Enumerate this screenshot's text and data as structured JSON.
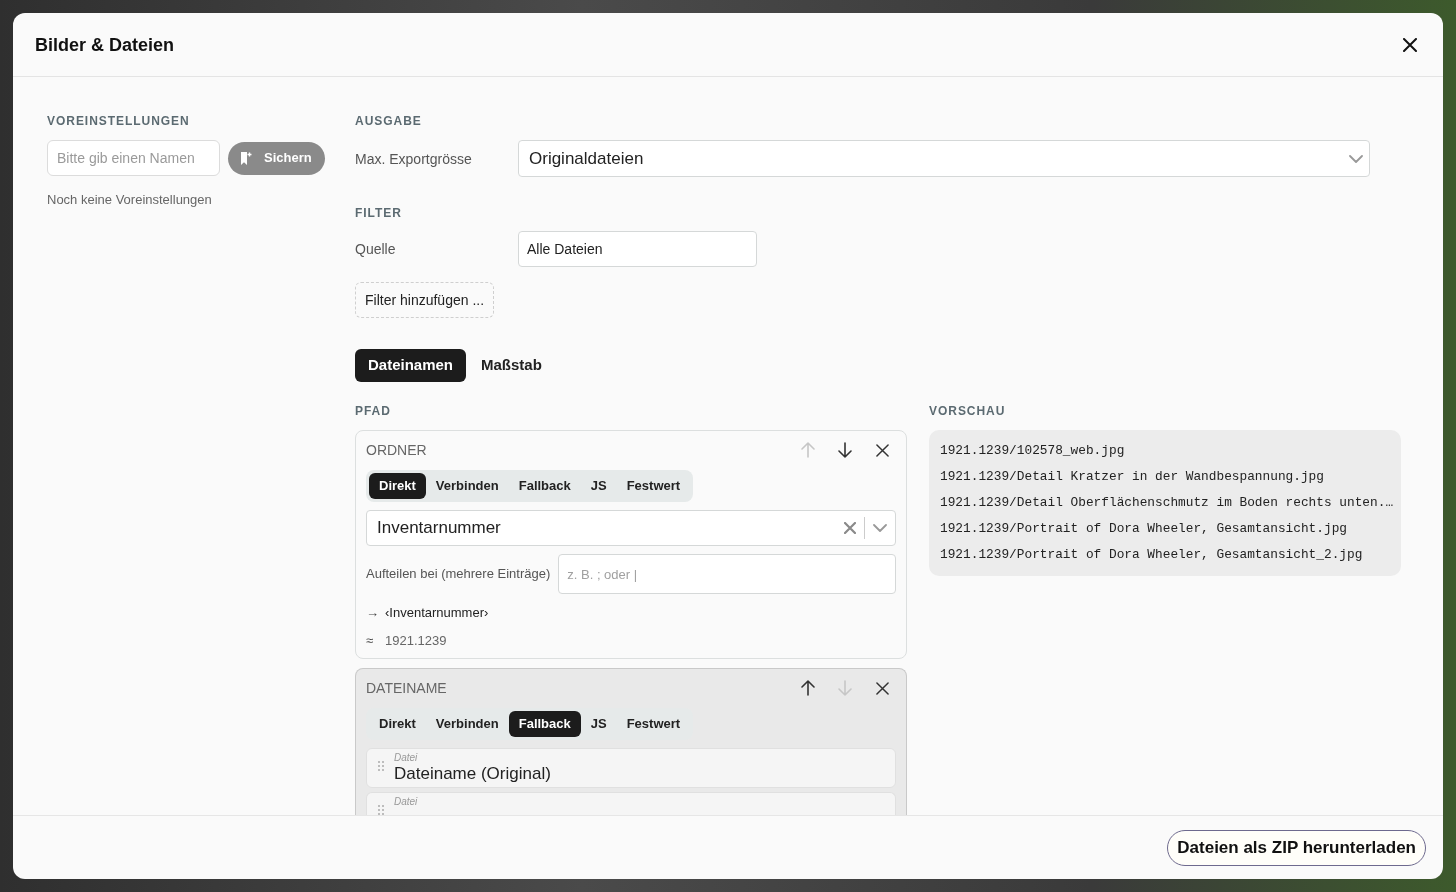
{
  "window": {
    "title": "Bilder & Dateien"
  },
  "presets": {
    "heading": "VOREINSTELLUNGEN",
    "name_field": {
      "placeholder": "Bitte gib einen Namen"
    },
    "save_button": {
      "label": "Sichern",
      "disabled": true
    },
    "empty_text": "Noch keine Voreinstellungen"
  },
  "output": {
    "heading": "AUSGABE",
    "max_export_size": {
      "label": "Max. Exportgrösse",
      "value": "Originaldateien"
    }
  },
  "filter": {
    "heading": "FILTER",
    "source": {
      "label": "Quelle",
      "value": "Alle Dateien"
    },
    "add_button": "Filter hinzufügen ..."
  },
  "tabs": [
    {
      "label": "Dateinamen",
      "selected": true
    },
    {
      "label": "Maßstab",
      "selected": false
    }
  ],
  "path": {
    "heading": "PFAD",
    "segments": [
      {
        "title": "ORDNER",
        "kind": "field",
        "highlighted": false,
        "move_up_enabled": false,
        "move_down_enabled": true,
        "modes": [
          {
            "label": "Direkt",
            "selected": true
          },
          {
            "label": "Verbinden",
            "selected": false
          },
          {
            "label": "Fallback",
            "selected": false
          },
          {
            "label": "JS",
            "selected": false
          },
          {
            "label": "Festwert",
            "selected": false
          }
        ],
        "field": {
          "value": "Inventarnummer"
        },
        "split": {
          "label": "Aufteilen bei (mehrere Einträge)",
          "placeholder": "z. B. ; oder |"
        },
        "template": {
          "symbol": "→",
          "text": "‹Inventarnummer›"
        },
        "result": {
          "symbol": "≈",
          "text": "1921.1239"
        }
      },
      {
        "title": "DATEINAME",
        "kind": "fallback",
        "highlighted": true,
        "move_up_enabled": true,
        "move_down_enabled": false,
        "modes": [
          {
            "label": "Direkt",
            "selected": false
          },
          {
            "label": "Verbinden",
            "selected": false
          },
          {
            "label": "Fallback",
            "selected": true
          },
          {
            "label": "JS",
            "selected": false
          },
          {
            "label": "Festwert",
            "selected": false
          }
        ],
        "fallback_items": [
          {
            "category": "Datei",
            "label": "Dateiname (Original)"
          },
          {
            "category": "Datei"
          }
        ]
      }
    ]
  },
  "preview": {
    "heading": "VORSCHAU",
    "lines": [
      "1921.1239/102578_web.jpg",
      "1921.1239/Detail Kratzer in der Wandbespannung.jpg",
      "1921.1239/Detail Oberflächenschmutz im Boden rechts unten.…",
      "1921.1239/Portrait of Dora Wheeler, Gesamtansicht.jpg",
      "1921.1239/Portrait of Dora Wheeler, Gesamtansicht_2.jpg"
    ]
  },
  "footer": {
    "download_button": "Dateien als ZIP herunterladen"
  }
}
